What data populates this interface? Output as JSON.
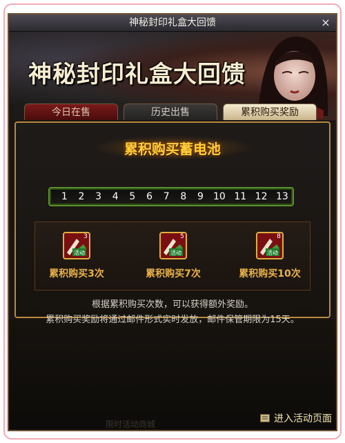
{
  "window": {
    "title": "神秘封印礼盒大回馈",
    "close_icon": "×"
  },
  "banner": {
    "title": "神秘封印礼盒大回馈"
  },
  "tabs": [
    {
      "label": "今日在售",
      "state": "inactive"
    },
    {
      "label": "历史出售",
      "state": "inactive"
    },
    {
      "label": "累积购买奖励",
      "state": "active"
    }
  ],
  "panel": {
    "section_title": "累积购买蓄电池",
    "progress_steps": [
      "1",
      "2",
      "3",
      "4",
      "5",
      "6",
      "7",
      "8",
      "9",
      "10",
      "11",
      "12",
      "13"
    ],
    "rewards": [
      {
        "icon": "reward-box-icon",
        "badge": "3",
        "icon_text": "活动",
        "label": "累积购买3次"
      },
      {
        "icon": "reward-box-icon",
        "badge": "5",
        "icon_text": "活动",
        "label": "累积购买7次"
      },
      {
        "icon": "reward-box-icon",
        "badge": "8",
        "icon_text": "活动",
        "label": "累积购买10次"
      }
    ]
  },
  "description": {
    "line1": "根据累积购买次数，可以获得额外奖励。",
    "line2": "累积购买奖励将通过邮件形式实时发放，邮件保管期限为15天。"
  },
  "footer": {
    "enter_label": "进入活动页面",
    "faint_text": "限时活动商城"
  },
  "colors": {
    "accent_gold": "#ffce3a",
    "reward_label": "#e9b24a",
    "progress_border": "#5c8f2c"
  }
}
